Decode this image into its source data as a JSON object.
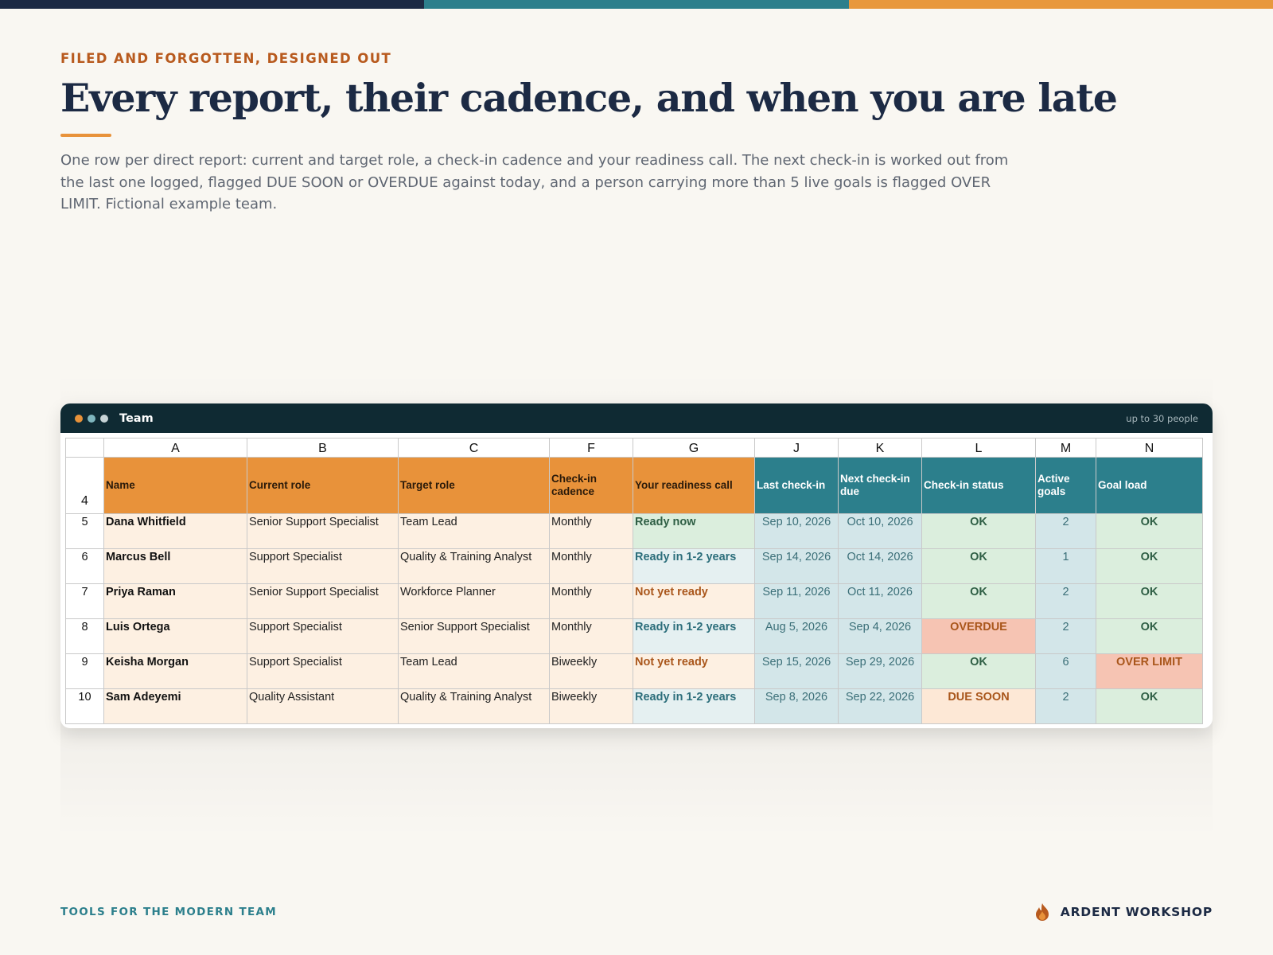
{
  "colors": {
    "navy": "#1c2a44",
    "teal": "#2c7f8c",
    "orange": "#e8923a",
    "rust": "#b85a1e"
  },
  "eyebrow": "FILED AND FORGOTTEN, DESIGNED OUT",
  "title": "Every report, their cadence, and when you are late",
  "description": "One row per direct report: current and target role, a check-in cadence and your readiness call. The next check-in is worked out from the last one logged, flagged DUE SOON or OVERDUE against today, and a person carrying more than 5 live goals is flagged OVER LIMIT. Fictional example team.",
  "window": {
    "title": "Team",
    "note": "up to 30 people",
    "controls": [
      "window-dot-orange",
      "window-dot-teal",
      "window-dot-grey"
    ]
  },
  "sheet": {
    "column_letters": [
      "A",
      "B",
      "C",
      "F",
      "G",
      "J",
      "K",
      "L",
      "M",
      "N"
    ],
    "header_row_number": "4",
    "headers": [
      "Name",
      "Current role",
      "Target role",
      "Check-in cadence",
      "Your readiness call",
      "Last check-in",
      "Next check-in due",
      "Check-in status",
      "Active goals",
      "Goal load"
    ],
    "rows": [
      {
        "num": "5",
        "name": "Dana Whitfield",
        "current": "Senior Support Specialist",
        "target": "Team Lead",
        "cadence": "Monthly",
        "readiness": "Ready now",
        "last": "Sep 10, 2026",
        "next": "Oct 10, 2026",
        "status": "OK",
        "goals": "2",
        "load": "OK"
      },
      {
        "num": "6",
        "name": "Marcus Bell",
        "current": "Support Specialist",
        "target": "Quality & Training Analyst",
        "cadence": "Monthly",
        "readiness": "Ready in 1-2 years",
        "last": "Sep 14, 2026",
        "next": "Oct 14, 2026",
        "status": "OK",
        "goals": "1",
        "load": "OK"
      },
      {
        "num": "7",
        "name": "Priya Raman",
        "current": "Senior Support Specialist",
        "target": "Workforce Planner",
        "cadence": "Monthly",
        "readiness": "Not yet ready",
        "last": "Sep 11, 2026",
        "next": "Oct 11, 2026",
        "status": "OK",
        "goals": "2",
        "load": "OK"
      },
      {
        "num": "8",
        "name": "Luis Ortega",
        "current": "Support Specialist",
        "target": "Senior Support Specialist",
        "cadence": "Monthly",
        "readiness": "Ready in 1-2 years",
        "last": "Aug 5, 2026",
        "next": "Sep 4, 2026",
        "status": "OVERDUE",
        "goals": "2",
        "load": "OK"
      },
      {
        "num": "9",
        "name": "Keisha Morgan",
        "current": "Support Specialist",
        "target": "Team Lead",
        "cadence": "Biweekly",
        "readiness": "Not yet ready",
        "last": "Sep 15, 2026",
        "next": "Sep 29, 2026",
        "status": "OK",
        "goals": "6",
        "load": "OVER LIMIT"
      },
      {
        "num": "10",
        "name": "Sam Adeyemi",
        "current": "Quality Assistant",
        "target": "Quality & Training Analyst",
        "cadence": "Biweekly",
        "readiness": "Ready in 1-2 years",
        "last": "Sep 8, 2026",
        "next": "Sep 22, 2026",
        "status": "DUE SOON",
        "goals": "2",
        "load": "OK"
      }
    ]
  },
  "footer": {
    "tagline": "TOOLS FOR THE MODERN TEAM",
    "brand": "ARDENT WORKSHOP",
    "brand_icon": "flame-icon"
  }
}
